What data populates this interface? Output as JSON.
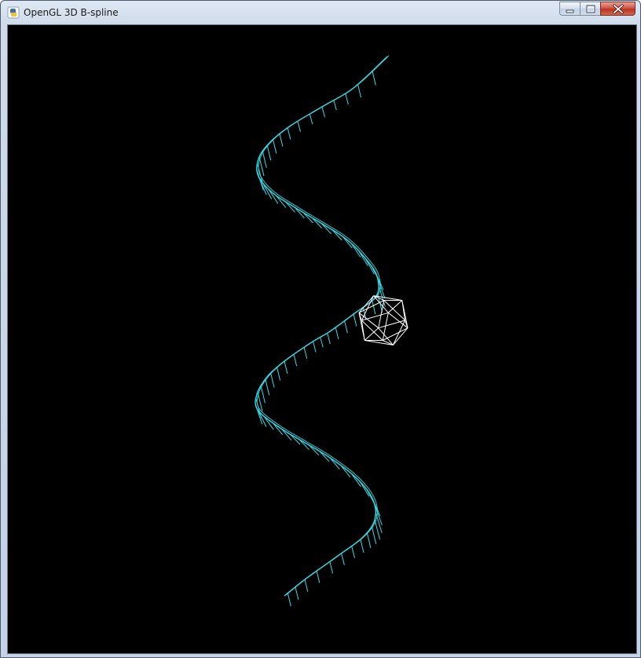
{
  "window": {
    "title": "OpenGL 3D B-spline",
    "icon": "python-icon",
    "controls": [
      "minimize-icon",
      "maximize-icon",
      "close-icon"
    ]
  },
  "scene": {
    "background_color": "#000000",
    "spline_color": "#33dde8",
    "polyhedron_color": "#ffffff",
    "polyhedron": "icosahedron-wireframe"
  }
}
